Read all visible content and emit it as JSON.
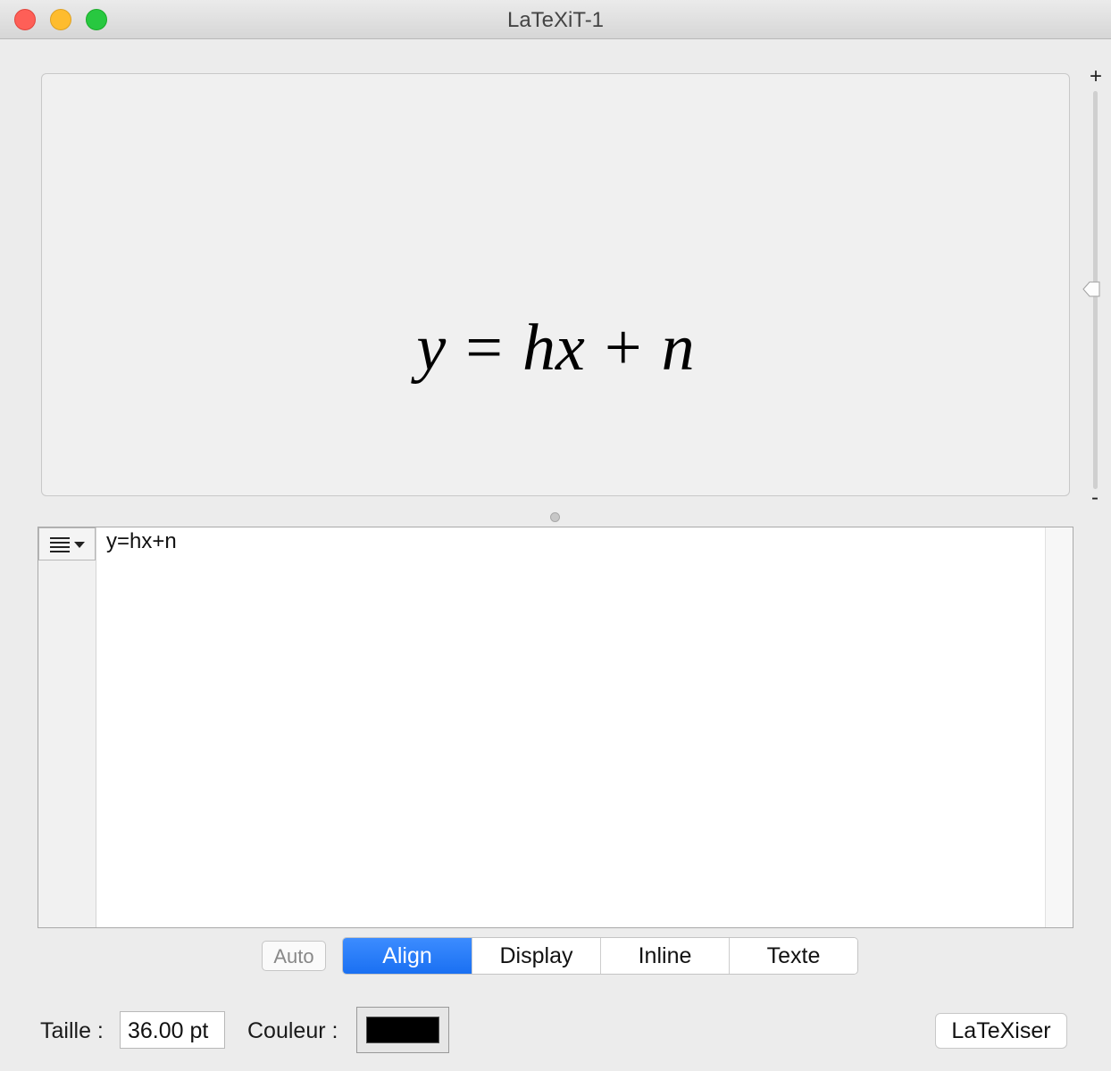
{
  "window": {
    "title": "LaTeXiT-1"
  },
  "preview": {
    "formula": {
      "y": "y",
      "eq": "=",
      "h": "h",
      "x": "x",
      "plus": "+",
      "n": "n"
    }
  },
  "zoom": {
    "plus": "+",
    "minus": "-"
  },
  "editor": {
    "text": "y=hx+n"
  },
  "modes": {
    "auto": "Auto",
    "items": [
      "Align",
      "Display",
      "Inline",
      "Texte"
    ],
    "selected": "Align"
  },
  "bottom": {
    "size_label": "Taille :",
    "size_value": "36.00 pt",
    "color_label": "Couleur :",
    "color_value": "#000000",
    "latexise_label": "LaTeXiser"
  }
}
